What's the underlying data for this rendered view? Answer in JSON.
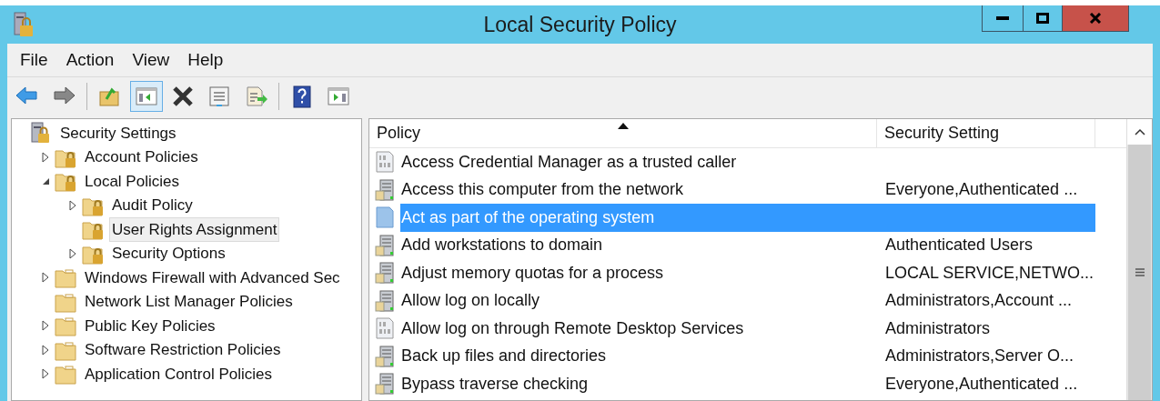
{
  "window": {
    "title": "Local Security Policy"
  },
  "menu": [
    "File",
    "Action",
    "View",
    "Help"
  ],
  "toolbar": [
    [
      {
        "kind": "back",
        "pressed": false
      },
      {
        "kind": "forward",
        "pressed": false
      }
    ],
    [
      {
        "kind": "up",
        "pressed": false
      },
      {
        "kind": "tree",
        "pressed": true
      },
      {
        "kind": "delete",
        "pressed": false
      },
      {
        "kind": "properties",
        "pressed": false
      },
      {
        "kind": "export",
        "pressed": false
      }
    ],
    [
      {
        "kind": "help",
        "pressed": false
      },
      {
        "kind": "pane",
        "pressed": false
      }
    ]
  ],
  "tree": [
    {
      "label": "Security Settings",
      "kind": "root",
      "selected": false,
      "children": [
        {
          "label": "Account Policies",
          "kind": "secure-folder",
          "expanded": false,
          "selected": false
        },
        {
          "label": "Local Policies",
          "kind": "secure-folder",
          "expanded": true,
          "selected": false,
          "children": [
            {
              "label": "Audit Policy",
              "kind": "secure-folder",
              "expanded": false,
              "selected": false
            },
            {
              "label": "User Rights Assignment",
              "kind": "secure-folder",
              "selected": true
            },
            {
              "label": "Security Options",
              "kind": "secure-folder",
              "expanded": false,
              "selected": false
            }
          ]
        },
        {
          "label": "Windows Firewall with Advanced Sec",
          "kind": "folder",
          "expanded": false,
          "selected": false
        },
        {
          "label": "Network List Manager Policies",
          "kind": "folder",
          "selected": false
        },
        {
          "label": "Public Key Policies",
          "kind": "folder",
          "expanded": false,
          "selected": false
        },
        {
          "label": "Software Restriction Policies",
          "kind": "folder",
          "expanded": false,
          "selected": false
        },
        {
          "label": "Application Control Policies",
          "kind": "folder",
          "expanded": false,
          "selected": false
        }
      ]
    }
  ],
  "table": {
    "columns": [
      {
        "label": "Policy",
        "sorted": true
      },
      {
        "label": "Security Setting",
        "sorted": false
      }
    ],
    "rows": [
      {
        "policy": "Access Credential Manager as a trusted caller",
        "kind": "binary",
        "selected": false
      },
      {
        "policy": "Access this computer from the network",
        "setting": "Everyone,Authenticated ...",
        "kind": "server",
        "selected": false
      },
      {
        "policy": "Act as part of the operating system",
        "kind": "binary",
        "selected": true
      },
      {
        "policy": "Add workstations to domain",
        "setting": "Authenticated Users",
        "kind": "server",
        "selected": false
      },
      {
        "policy": "Adjust memory quotas for a process",
        "setting": "LOCAL SERVICE,NETWO...",
        "kind": "server",
        "selected": false
      },
      {
        "policy": "Allow log on locally",
        "setting": "Administrators,Account ...",
        "kind": "server",
        "selected": false
      },
      {
        "policy": "Allow log on through Remote Desktop Services",
        "setting": "Administrators",
        "kind": "binary",
        "selected": false
      },
      {
        "policy": "Back up files and directories",
        "setting": "Administrators,Server O...",
        "kind": "server",
        "selected": false
      },
      {
        "policy": "Bypass traverse checking",
        "setting": "Everyone,Authenticated ...",
        "kind": "server",
        "selected": false
      }
    ]
  }
}
